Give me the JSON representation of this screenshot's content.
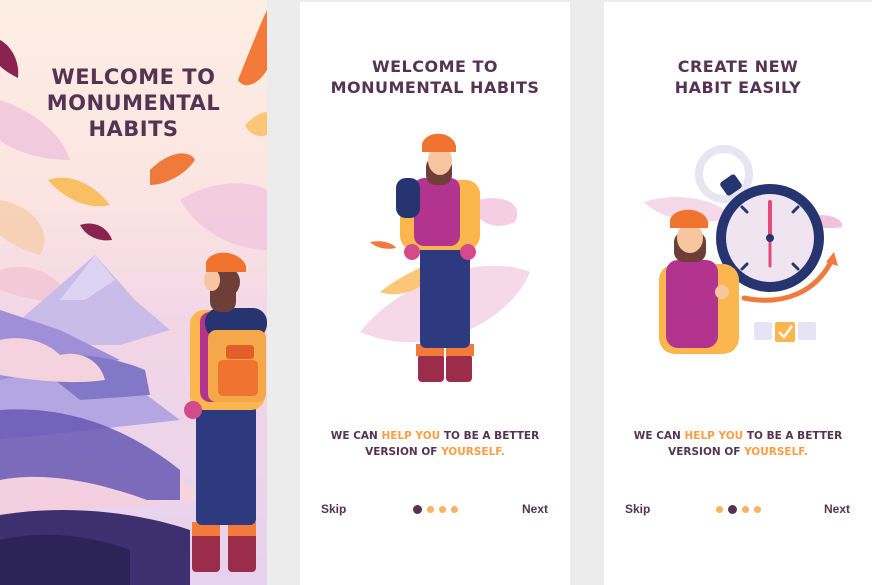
{
  "screens": [
    {
      "title_lines": [
        "WELCOME TO",
        "MONUMENTAL",
        "HABITS"
      ]
    },
    {
      "title_lines": [
        "WELCOME TO",
        "MONUMENTAL HABITS"
      ],
      "caption": {
        "line1_a": "WE CAN ",
        "line1_hl": "HELP YOU",
        "line1_b": " TO BE A BETTER",
        "line2_a": "VERSION OF ",
        "line2_hl": "YOURSELF."
      },
      "skip_label": "Skip",
      "next_label": "Next",
      "page_index": 1,
      "page_count": 4
    },
    {
      "title_lines": [
        "CREATE NEW",
        "HABIT EASILY"
      ],
      "caption": {
        "line1_a": "WE CAN ",
        "line1_hl": "HELP YOU",
        "line1_b": " TO BE A BETTER",
        "line2_a": "VERSION OF ",
        "line2_hl": "YOURSELF."
      },
      "skip_label": "Skip",
      "next_label": "Next",
      "page_index": 2,
      "page_count": 4
    }
  ],
  "colors": {
    "primary": "#573353",
    "accent": "#fc9d45",
    "dot": "#fdb25f"
  }
}
